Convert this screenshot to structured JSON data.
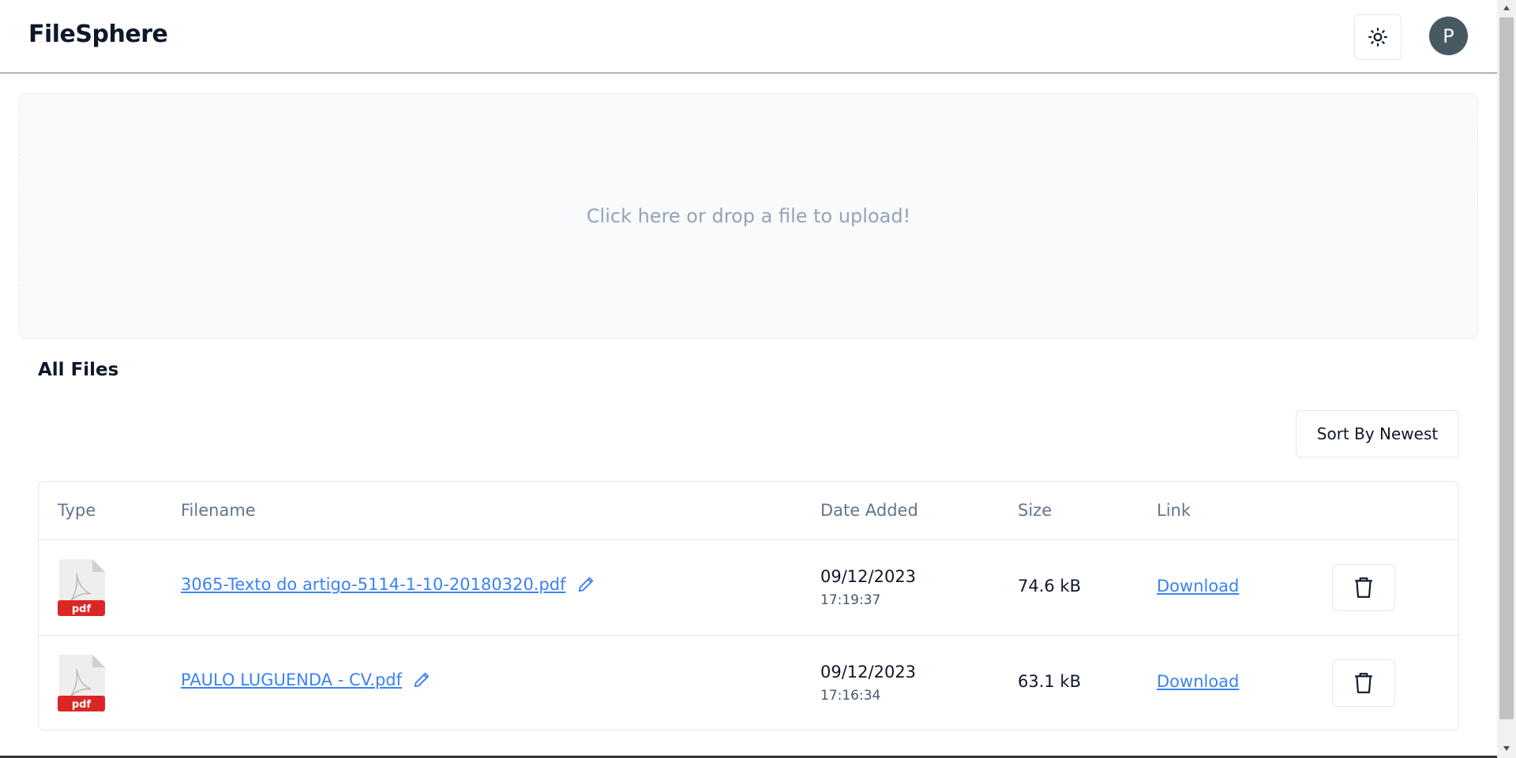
{
  "app": {
    "title": "FileSphere"
  },
  "header": {
    "theme_icon": "sun-icon",
    "avatar_letter": "P"
  },
  "upload": {
    "prompt": "Click here or drop a file to upload!"
  },
  "files_section": {
    "title": "All Files",
    "sort_label": "Sort By Newest"
  },
  "table": {
    "headers": {
      "type": "Type",
      "filename": "Filename",
      "date": "Date Added",
      "size": "Size",
      "link": "Link"
    },
    "rows": [
      {
        "type_badge": "pdf",
        "filename": "3065-Texto do artigo-5114-1-10-20180320.pdf",
        "date": "09/12/2023",
        "time": "17:19:37",
        "size": "74.6 kB",
        "link": "Download"
      },
      {
        "type_badge": "pdf",
        "filename": "PAULO LUGUENDA - CV.pdf",
        "date": "09/12/2023",
        "time": "17:16:34",
        "size": "63.1 kB",
        "link": "Download"
      }
    ]
  },
  "colors": {
    "accent": "#3b82f6",
    "pdf_red": "#dc2626",
    "avatar_bg": "#475a64",
    "dropzone_bg": "#f8fafc"
  }
}
